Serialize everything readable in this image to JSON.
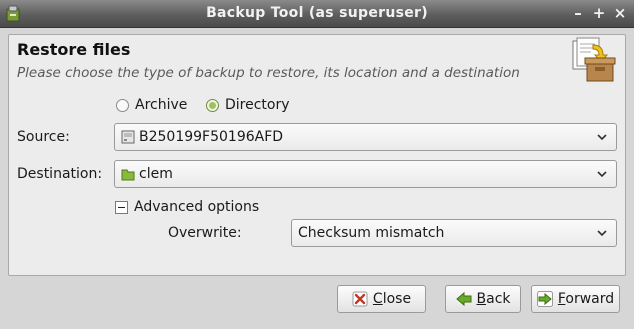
{
  "window": {
    "title": "Backup Tool (as superuser)",
    "controls": [
      "–",
      "+",
      "×"
    ]
  },
  "header": {
    "title": "Restore files",
    "subtitle": "Please choose the type of backup to restore, its location and a destination"
  },
  "backup_type": {
    "options": [
      "Archive",
      "Directory"
    ],
    "selected": "Directory"
  },
  "source": {
    "label": "Source:",
    "value": "B250199F50196AFD",
    "icon": "drive-icon"
  },
  "destination": {
    "label": "Destination:",
    "value": "clem",
    "icon": "folder-icon"
  },
  "advanced": {
    "label": "Advanced options",
    "expanded": true
  },
  "overwrite": {
    "label": "Overwrite:",
    "value": "Checksum mismatch"
  },
  "buttons": {
    "close": {
      "mnemonic": "C",
      "rest": "lose"
    },
    "back": {
      "mnemonic": "B",
      "rest": "ack"
    },
    "forward": {
      "mnemonic": "F",
      "rest": "orward"
    }
  },
  "colors": {
    "titlebar": "#5e5e5e",
    "panel": "#ececec",
    "close_icon": "#c0392b",
    "arrow_icon": "#4e9a06"
  }
}
